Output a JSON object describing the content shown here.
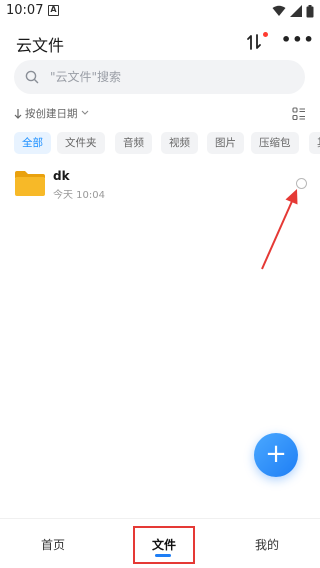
{
  "status_bar": {
    "time": "10:07",
    "notification_letter": "A",
    "icons": [
      "wifi-icon",
      "signal-icon",
      "battery-icon"
    ]
  },
  "header": {
    "title": "云文件",
    "sort_icon": "sort-arrows-icon",
    "more_icon": "more-icon",
    "more_label": "•••"
  },
  "search": {
    "placeholder": "\"云文件\"搜索"
  },
  "sort": {
    "label": "按创建日期",
    "toggle_icon": "grid-list-toggle-icon"
  },
  "filters": {
    "active_index": 0,
    "items": [
      "全部",
      "文件夹",
      "音频",
      "视频",
      "图片",
      "压缩包",
      "其"
    ]
  },
  "files": [
    {
      "name": "dk",
      "meta": "今天 10:04",
      "icon": "folder-icon"
    }
  ],
  "fab": {
    "label": "+"
  },
  "bottom_nav": {
    "items": [
      {
        "label": "首页",
        "active": false
      },
      {
        "label": "文件",
        "active": true
      },
      {
        "label": "我的",
        "active": false
      }
    ]
  },
  "colors": {
    "accent": "#1e7ef5",
    "folder": "#f7b928",
    "annotation": "#e53935"
  }
}
